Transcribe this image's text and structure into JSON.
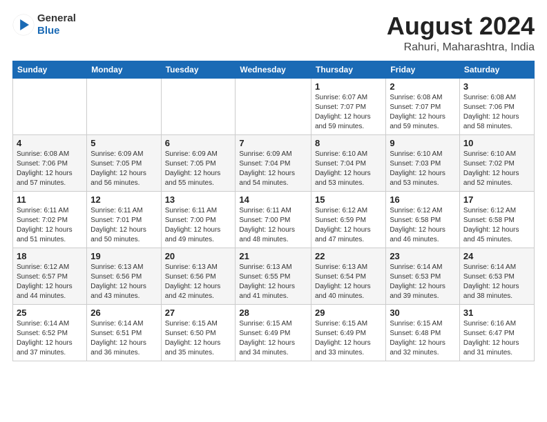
{
  "header": {
    "logo_line1": "General",
    "logo_line2": "Blue",
    "month_year": "August 2024",
    "location": "Rahuri, Maharashtra, India"
  },
  "days_of_week": [
    "Sunday",
    "Monday",
    "Tuesday",
    "Wednesday",
    "Thursday",
    "Friday",
    "Saturday"
  ],
  "weeks": [
    [
      {
        "day": "",
        "info": ""
      },
      {
        "day": "",
        "info": ""
      },
      {
        "day": "",
        "info": ""
      },
      {
        "day": "",
        "info": ""
      },
      {
        "day": "1",
        "info": "Sunrise: 6:07 AM\nSunset: 7:07 PM\nDaylight: 12 hours\nand 59 minutes."
      },
      {
        "day": "2",
        "info": "Sunrise: 6:08 AM\nSunset: 7:07 PM\nDaylight: 12 hours\nand 59 minutes."
      },
      {
        "day": "3",
        "info": "Sunrise: 6:08 AM\nSunset: 7:06 PM\nDaylight: 12 hours\nand 58 minutes."
      }
    ],
    [
      {
        "day": "4",
        "info": "Sunrise: 6:08 AM\nSunset: 7:06 PM\nDaylight: 12 hours\nand 57 minutes."
      },
      {
        "day": "5",
        "info": "Sunrise: 6:09 AM\nSunset: 7:05 PM\nDaylight: 12 hours\nand 56 minutes."
      },
      {
        "day": "6",
        "info": "Sunrise: 6:09 AM\nSunset: 7:05 PM\nDaylight: 12 hours\nand 55 minutes."
      },
      {
        "day": "7",
        "info": "Sunrise: 6:09 AM\nSunset: 7:04 PM\nDaylight: 12 hours\nand 54 minutes."
      },
      {
        "day": "8",
        "info": "Sunrise: 6:10 AM\nSunset: 7:04 PM\nDaylight: 12 hours\nand 53 minutes."
      },
      {
        "day": "9",
        "info": "Sunrise: 6:10 AM\nSunset: 7:03 PM\nDaylight: 12 hours\nand 53 minutes."
      },
      {
        "day": "10",
        "info": "Sunrise: 6:10 AM\nSunset: 7:02 PM\nDaylight: 12 hours\nand 52 minutes."
      }
    ],
    [
      {
        "day": "11",
        "info": "Sunrise: 6:11 AM\nSunset: 7:02 PM\nDaylight: 12 hours\nand 51 minutes."
      },
      {
        "day": "12",
        "info": "Sunrise: 6:11 AM\nSunset: 7:01 PM\nDaylight: 12 hours\nand 50 minutes."
      },
      {
        "day": "13",
        "info": "Sunrise: 6:11 AM\nSunset: 7:00 PM\nDaylight: 12 hours\nand 49 minutes."
      },
      {
        "day": "14",
        "info": "Sunrise: 6:11 AM\nSunset: 7:00 PM\nDaylight: 12 hours\nand 48 minutes."
      },
      {
        "day": "15",
        "info": "Sunrise: 6:12 AM\nSunset: 6:59 PM\nDaylight: 12 hours\nand 47 minutes."
      },
      {
        "day": "16",
        "info": "Sunrise: 6:12 AM\nSunset: 6:58 PM\nDaylight: 12 hours\nand 46 minutes."
      },
      {
        "day": "17",
        "info": "Sunrise: 6:12 AM\nSunset: 6:58 PM\nDaylight: 12 hours\nand 45 minutes."
      }
    ],
    [
      {
        "day": "18",
        "info": "Sunrise: 6:12 AM\nSunset: 6:57 PM\nDaylight: 12 hours\nand 44 minutes."
      },
      {
        "day": "19",
        "info": "Sunrise: 6:13 AM\nSunset: 6:56 PM\nDaylight: 12 hours\nand 43 minutes."
      },
      {
        "day": "20",
        "info": "Sunrise: 6:13 AM\nSunset: 6:56 PM\nDaylight: 12 hours\nand 42 minutes."
      },
      {
        "day": "21",
        "info": "Sunrise: 6:13 AM\nSunset: 6:55 PM\nDaylight: 12 hours\nand 41 minutes."
      },
      {
        "day": "22",
        "info": "Sunrise: 6:13 AM\nSunset: 6:54 PM\nDaylight: 12 hours\nand 40 minutes."
      },
      {
        "day": "23",
        "info": "Sunrise: 6:14 AM\nSunset: 6:53 PM\nDaylight: 12 hours\nand 39 minutes."
      },
      {
        "day": "24",
        "info": "Sunrise: 6:14 AM\nSunset: 6:53 PM\nDaylight: 12 hours\nand 38 minutes."
      }
    ],
    [
      {
        "day": "25",
        "info": "Sunrise: 6:14 AM\nSunset: 6:52 PM\nDaylight: 12 hours\nand 37 minutes."
      },
      {
        "day": "26",
        "info": "Sunrise: 6:14 AM\nSunset: 6:51 PM\nDaylight: 12 hours\nand 36 minutes."
      },
      {
        "day": "27",
        "info": "Sunrise: 6:15 AM\nSunset: 6:50 PM\nDaylight: 12 hours\nand 35 minutes."
      },
      {
        "day": "28",
        "info": "Sunrise: 6:15 AM\nSunset: 6:49 PM\nDaylight: 12 hours\nand 34 minutes."
      },
      {
        "day": "29",
        "info": "Sunrise: 6:15 AM\nSunset: 6:49 PM\nDaylight: 12 hours\nand 33 minutes."
      },
      {
        "day": "30",
        "info": "Sunrise: 6:15 AM\nSunset: 6:48 PM\nDaylight: 12 hours\nand 32 minutes."
      },
      {
        "day": "31",
        "info": "Sunrise: 6:16 AM\nSunset: 6:47 PM\nDaylight: 12 hours\nand 31 minutes."
      }
    ]
  ]
}
